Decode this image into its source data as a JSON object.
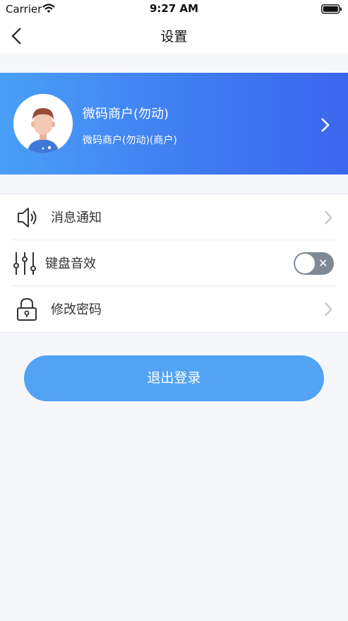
{
  "status_bar": {
    "carrier": "Carrier",
    "time": "9:27 AM"
  },
  "nav": {
    "title": "设置"
  },
  "profile": {
    "name": "微码商户(勿动)",
    "subtitle": "微码商户(勿动)(商户)"
  },
  "settings": {
    "items": [
      {
        "label": "消息通知",
        "icon": "speaker-icon",
        "control": "chevron"
      },
      {
        "label": "键盘音效",
        "icon": "sliders-icon",
        "control": "toggle",
        "toggle_on": false
      },
      {
        "label": "修改密码",
        "icon": "lock-icon",
        "control": "chevron"
      }
    ]
  },
  "logout": {
    "label": "退出登录"
  },
  "colors": {
    "accent": "#52a3f3",
    "banner_start": "#4a9ff7",
    "banner_end": "#3b66ee",
    "toggle_off": "#7d8a96"
  }
}
